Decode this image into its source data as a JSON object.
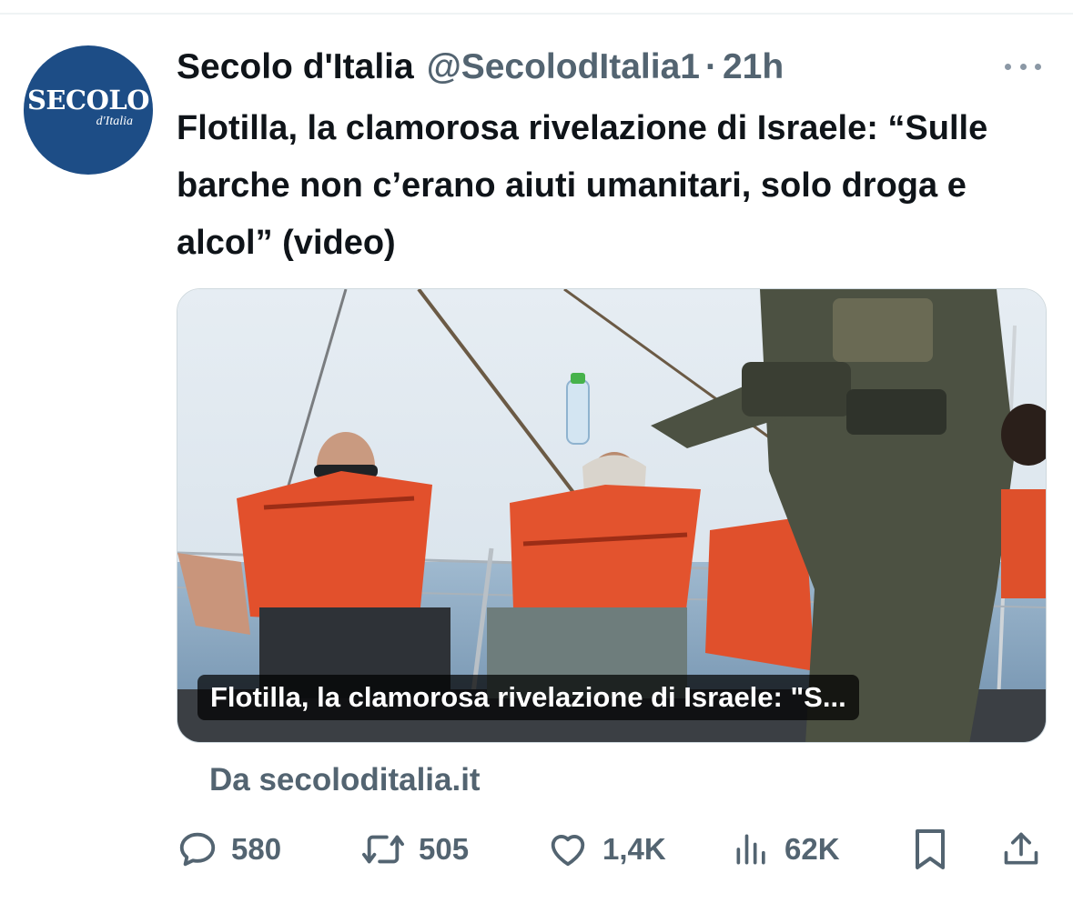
{
  "tweet": {
    "author": {
      "name": "Secolo d'Italia",
      "handle": "@SecolodItalia1",
      "avatar_text": "SECOLO",
      "avatar_subtext": "d'Italia"
    },
    "separator": "·",
    "time": "21h",
    "text": "Flotilla, la clamorosa rivelazione di Israele: “Sulle barche non c’erano aiuti umanitari, solo droga e alcol” (video)",
    "card": {
      "title": "Flotilla, la clamorosa rivelazione di Israele: \"S...",
      "source": "Da secoloditalia.it"
    },
    "metrics": {
      "replies": "580",
      "retweets": "505",
      "likes": "1,4K",
      "views": "62K"
    }
  },
  "colors": {
    "text_primary": "#0f1419",
    "text_secondary": "#536471",
    "avatar_bg": "#1d4d86",
    "divider": "#eff3f4"
  },
  "icons": {
    "reply": "speech-bubble-icon",
    "retweet": "retweet-arrows-icon",
    "like": "heart-icon",
    "views": "bar-chart-icon",
    "bookmark": "bookmark-icon",
    "share": "share-upload-icon",
    "more": "more-dots-icon"
  }
}
